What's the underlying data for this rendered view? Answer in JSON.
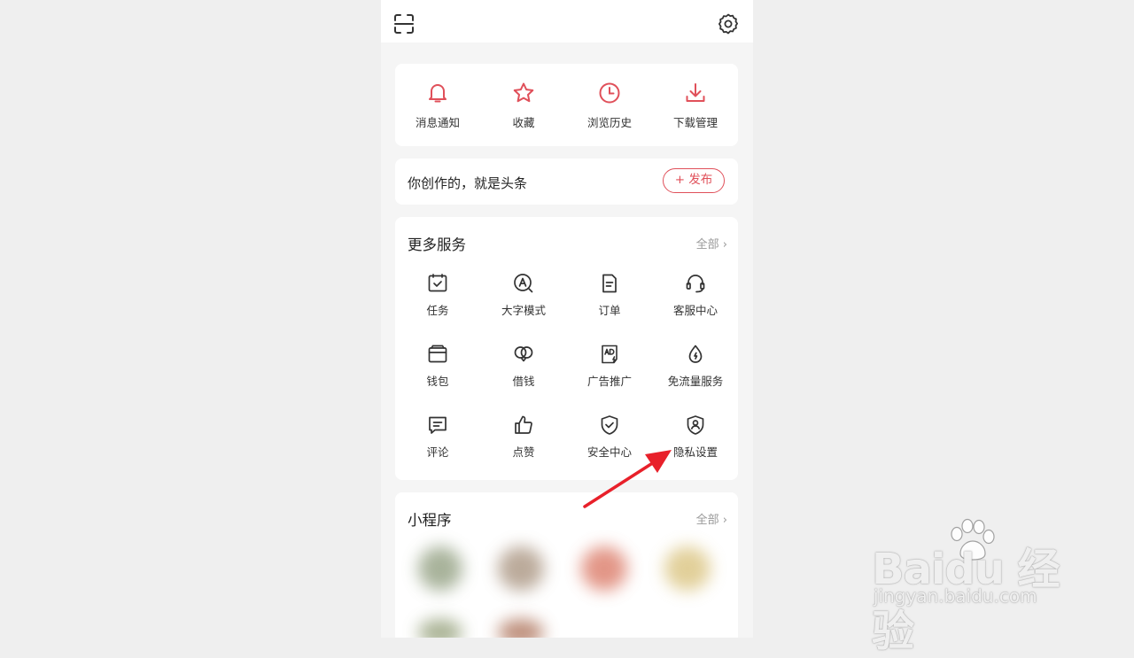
{
  "quick_actions": [
    {
      "label": "消息通知",
      "icon": "bell-icon"
    },
    {
      "label": "收藏",
      "icon": "star-icon"
    },
    {
      "label": "浏览历史",
      "icon": "clock-icon"
    },
    {
      "label": "下载管理",
      "icon": "download-icon"
    }
  ],
  "publish": {
    "slogan": "你创作的，就是头条",
    "button_label": "+ 发布"
  },
  "services": {
    "title": "更多服务",
    "more": "全部 ›",
    "items": [
      {
        "label": "任务",
        "icon": "task-calendar-icon"
      },
      {
        "label": "大字模式",
        "icon": "large-font-icon"
      },
      {
        "label": "订单",
        "icon": "order-icon"
      },
      {
        "label": "客服中心",
        "icon": "headset-icon"
      },
      {
        "label": "钱包",
        "icon": "wallet-icon"
      },
      {
        "label": "借钱",
        "icon": "loan-icon"
      },
      {
        "label": "广告推广",
        "icon": "ad-icon"
      },
      {
        "label": "免流量服务",
        "icon": "data-free-icon"
      },
      {
        "label": "评论",
        "icon": "comment-icon"
      },
      {
        "label": "点赞",
        "icon": "thumbs-up-icon"
      },
      {
        "label": "安全中心",
        "icon": "shield-check-icon"
      },
      {
        "label": "隐私设置",
        "icon": "privacy-icon"
      }
    ]
  },
  "mini_programs": {
    "title": "小程序",
    "more": "全部 ›"
  },
  "watermark": {
    "logo": "Baidu 经验",
    "url": "jingyan.baidu.com"
  },
  "colors": {
    "accent": "#e0505a",
    "icon_dark": "#333333",
    "arrow": "#e8202a"
  }
}
